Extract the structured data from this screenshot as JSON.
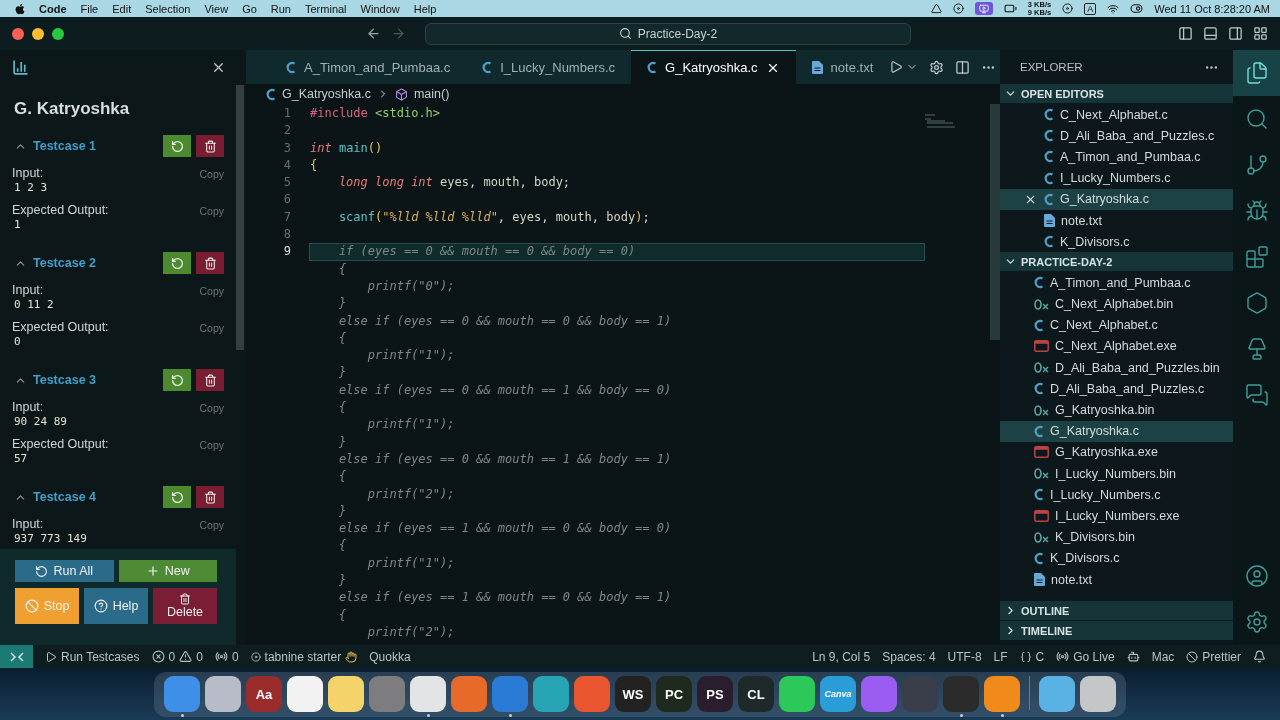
{
  "menubar": {
    "app": "Code",
    "menus": [
      "File",
      "Edit",
      "Selection",
      "View",
      "Go",
      "Run",
      "Terminal",
      "Window",
      "Help"
    ],
    "net_up": "3 KB/s",
    "net_down": "9 KB/s",
    "input_source": "A",
    "clock": "Wed 11 Oct 8:28:20 AM"
  },
  "title_bar": {
    "search": "Practice-Day-2"
  },
  "test_panel": {
    "problem": "G. Katryoshka",
    "testcases": [
      {
        "title": "Testcase 1",
        "expanded": true,
        "fields": [
          {
            "label": "Input:",
            "value": "1 2 3",
            "copy": "Copy"
          },
          {
            "label": "Expected Output:",
            "value": "1",
            "copy": "Copy"
          }
        ]
      },
      {
        "title": "Testcase 2",
        "expanded": true,
        "fields": [
          {
            "label": "Input:",
            "value": "0 11 2",
            "copy": "Copy"
          },
          {
            "label": "Expected Output:",
            "value": "0",
            "copy": "Copy"
          }
        ]
      },
      {
        "title": "Testcase 3",
        "expanded": true,
        "fields": [
          {
            "label": "Input:",
            "value": "90 24 89",
            "copy": "Copy"
          },
          {
            "label": "Expected Output:",
            "value": "57",
            "copy": "Copy"
          }
        ]
      },
      {
        "title": "Testcase 4",
        "expanded": true,
        "fields": [
          {
            "label": "Input:",
            "value": "937 773 149",
            "copy": "Copy"
          }
        ]
      }
    ],
    "actions": [
      {
        "buttons": [
          {
            "kind": "run_all",
            "label": "Run All"
          },
          {
            "kind": "new",
            "label": "New"
          }
        ]
      },
      {
        "buttons": [
          {
            "kind": "stop",
            "label": "Stop"
          },
          {
            "kind": "help",
            "label": "Help"
          },
          {
            "kind": "delete",
            "label": "Delete"
          }
        ]
      }
    ]
  },
  "tabs": [
    {
      "label": "A_Timon_and_Pumbaa.c",
      "kind": "c",
      "selected": false
    },
    {
      "label": "I_Lucky_Numbers.c",
      "kind": "c",
      "selected": false
    },
    {
      "label": "G_Katryoshka.c",
      "kind": "c",
      "selected": true
    },
    {
      "label": "note.txt",
      "kind": "txt",
      "selected": false
    }
  ],
  "editor": {
    "breadcrumb": {
      "file": "G_Katryoshka.c",
      "symbol": "main()"
    },
    "lines": [
      {
        "number": "1",
        "current": false,
        "tokens": [
          {
            "text": "#include ",
            "kind": "directive"
          },
          {
            "text": "<stdio.h>",
            "kind": "header"
          }
        ]
      },
      {
        "number": "2",
        "current": false
      },
      {
        "number": "3",
        "current": false,
        "tokens": [
          {
            "text": "int ",
            "kind": "type"
          },
          {
            "text": "main",
            "kind": "func"
          },
          {
            "text": "()",
            "kind": "paren"
          }
        ]
      },
      {
        "number": "4",
        "current": false,
        "tokens": [
          {
            "text": "{",
            "kind": "paren"
          }
        ]
      },
      {
        "number": "5",
        "current": false,
        "tokens": [
          {
            "text": "    long long int",
            "kind": "type"
          },
          {
            "text": " eyes, mouth, body;",
            "kind": "plain"
          }
        ]
      },
      {
        "number": "6",
        "current": false
      },
      {
        "number": "7",
        "current": false,
        "tokens": [
          {
            "text": "    scanf",
            "kind": "func"
          },
          {
            "text": "(",
            "kind": "paren"
          },
          {
            "text": "\"%lld %lld %lld\"",
            "kind": "string"
          },
          {
            "text": ", eyes, mouth, body",
            "kind": "plain"
          },
          {
            "text": ")",
            "kind": "paren"
          },
          {
            "text": ";",
            "kind": "plain"
          }
        ]
      },
      {
        "number": "8",
        "current": false
      },
      {
        "number": "9",
        "current": true,
        "tokens": [
          {
            "text": "    if (eyes == 0 && mouth == 0 && body == 0)",
            "kind": "ghost"
          }
        ]
      },
      {
        "current": false,
        "tokens": [
          {
            "text": "    {",
            "kind": "ghost"
          }
        ]
      },
      {
        "current": false,
        "tokens": [
          {
            "text": "        printf(\"0\");",
            "kind": "ghost"
          }
        ]
      },
      {
        "current": false,
        "tokens": [
          {
            "text": "    }",
            "kind": "ghost"
          }
        ]
      },
      {
        "current": false,
        "tokens": [
          {
            "text": "    else if (eyes == 0 && mouth == 0 && body == 1)",
            "kind": "ghost"
          }
        ]
      },
      {
        "current": false,
        "tokens": [
          {
            "text": "    {",
            "kind": "ghost"
          }
        ]
      },
      {
        "current": false,
        "tokens": [
          {
            "text": "        printf(\"1\");",
            "kind": "ghost"
          }
        ]
      },
      {
        "current": false,
        "tokens": [
          {
            "text": "    }",
            "kind": "ghost"
          }
        ]
      },
      {
        "current": false,
        "tokens": [
          {
            "text": "    else if (eyes == 0 && mouth == 1 && body == 0)",
            "kind": "ghost"
          }
        ]
      },
      {
        "current": false,
        "tokens": [
          {
            "text": "    {",
            "kind": "ghost"
          }
        ]
      },
      {
        "current": false,
        "tokens": [
          {
            "text": "        printf(\"1\");",
            "kind": "ghost"
          }
        ]
      },
      {
        "current": false,
        "tokens": [
          {
            "text": "    }",
            "kind": "ghost"
          }
        ]
      },
      {
        "current": false,
        "tokens": [
          {
            "text": "    else if (eyes == 0 && mouth == 1 && body == 1)",
            "kind": "ghost"
          }
        ]
      },
      {
        "current": false,
        "tokens": [
          {
            "text": "    {",
            "kind": "ghost"
          }
        ]
      },
      {
        "current": false,
        "tokens": [
          {
            "text": "        printf(\"2\");",
            "kind": "ghost"
          }
        ]
      },
      {
        "current": false,
        "tokens": [
          {
            "text": "    }",
            "kind": "ghost"
          }
        ]
      },
      {
        "current": false,
        "tokens": [
          {
            "text": "    else if (eyes == 1 && mouth == 0 && body == 0)",
            "kind": "ghost"
          }
        ]
      },
      {
        "current": false,
        "tokens": [
          {
            "text": "    {",
            "kind": "ghost"
          }
        ]
      },
      {
        "current": false,
        "tokens": [
          {
            "text": "        printf(\"1\");",
            "kind": "ghost"
          }
        ]
      },
      {
        "current": false,
        "tokens": [
          {
            "text": "    }",
            "kind": "ghost"
          }
        ]
      },
      {
        "current": false,
        "tokens": [
          {
            "text": "    else if (eyes == 1 && mouth == 0 && body == 1)",
            "kind": "ghost"
          }
        ]
      },
      {
        "current": false,
        "tokens": [
          {
            "text": "    {",
            "kind": "ghost"
          }
        ]
      },
      {
        "current": false,
        "tokens": [
          {
            "text": "        printf(\"2\");",
            "kind": "ghost"
          }
        ]
      }
    ]
  },
  "explorer": {
    "title": "EXPLORER",
    "sections": [
      {
        "title": "OPEN EDITORS",
        "expanded": true,
        "items": [
          {
            "name": "C_Next_Alphabet.c",
            "kind": "c",
            "selected": false
          },
          {
            "name": "D_Ali_Baba_and_Puzzles.c",
            "kind": "c",
            "selected": false
          },
          {
            "name": "A_Timon_and_Pumbaa.c",
            "kind": "c",
            "selected": false
          },
          {
            "name": "I_Lucky_Numbers.c",
            "kind": "c",
            "selected": false
          },
          {
            "name": "G_Katryoshka.c",
            "kind": "c",
            "selected": true
          },
          {
            "name": "note.txt",
            "kind": "txt",
            "selected": false
          },
          {
            "name": "K_Divisors.c",
            "kind": "c",
            "selected": false
          }
        ]
      },
      {
        "title": "PRACTICE-DAY-2",
        "expanded": true,
        "items": [
          {
            "name": "A_Timon_and_Pumbaa.c",
            "kind": "c",
            "selected": false
          },
          {
            "name": "C_Next_Alphabet.bin",
            "kind": "bin",
            "selected": false
          },
          {
            "name": "C_Next_Alphabet.c",
            "kind": "c",
            "selected": false
          },
          {
            "name": "C_Next_Alphabet.exe",
            "kind": "exe",
            "selected": false
          },
          {
            "name": "D_Ali_Baba_and_Puzzles.bin",
            "kind": "bin",
            "selected": false
          },
          {
            "name": "D_Ali_Baba_and_Puzzles.c",
            "kind": "c",
            "selected": false
          },
          {
            "name": "G_Katryoshka.bin",
            "kind": "bin",
            "selected": false
          },
          {
            "name": "G_Katryoshka.c",
            "kind": "c",
            "selected": true
          },
          {
            "name": "G_Katryoshka.exe",
            "kind": "exe",
            "selected": false
          },
          {
            "name": "I_Lucky_Numbers.bin",
            "kind": "bin",
            "selected": false
          },
          {
            "name": "I_Lucky_Numbers.c",
            "kind": "c",
            "selected": false
          },
          {
            "name": "I_Lucky_Numbers.exe",
            "kind": "exe",
            "selected": false
          },
          {
            "name": "K_Divisors.bin",
            "kind": "bin",
            "selected": false
          },
          {
            "name": "K_Divisors.c",
            "kind": "c",
            "selected": false
          },
          {
            "name": "note.txt",
            "kind": "txt",
            "selected": false
          }
        ]
      },
      {
        "title": "OUTLINE",
        "expanded": false
      },
      {
        "title": "TIMELINE",
        "expanded": false
      }
    ]
  },
  "activity_bar": [
    {
      "kind": "files",
      "selected": true
    },
    {
      "kind": "search",
      "selected": false
    },
    {
      "kind": "source_control",
      "selected": false
    },
    {
      "kind": "run_debug",
      "selected": false
    },
    {
      "kind": "extensions",
      "selected": false
    },
    {
      "kind": "hexagon",
      "selected": false
    },
    {
      "kind": "lamp",
      "selected": false
    },
    {
      "kind": "chat",
      "selected": false
    },
    {
      "kind": "account",
      "selected": false
    },
    {
      "kind": "settings",
      "selected": false
    }
  ],
  "status_bar": {
    "left": [
      {
        "kind": "run",
        "label": "Run Testcases"
      },
      {
        "kind": "problems",
        "errors": "0",
        "warnings": "0"
      },
      {
        "kind": "ports",
        "label": "0"
      },
      {
        "kind": "tabnine",
        "label": "tabnine starter"
      },
      {
        "kind": "plain",
        "label": "Quokka"
      }
    ],
    "right": [
      {
        "kind": "plain",
        "label": "Ln 9, Col 5"
      },
      {
        "kind": "plain",
        "label": "Spaces: 4"
      },
      {
        "kind": "plain",
        "label": "UTF-8"
      },
      {
        "kind": "plain",
        "label": "LF"
      },
      {
        "kind": "language",
        "label": "C"
      },
      {
        "kind": "golive",
        "label": "Go Live"
      },
      {
        "kind": "copilot"
      },
      {
        "kind": "plain",
        "label": "Mac"
      },
      {
        "kind": "prettier",
        "label": "Prettier"
      },
      {
        "kind": "bell"
      }
    ]
  },
  "dock": {
    "apps": [
      {
        "color": "#3d8fe8",
        "running": true
      },
      {
        "color": "#b8bcc8",
        "running": false
      },
      {
        "color": "#9a2c2c",
        "label": "Aa",
        "running": false
      },
      {
        "color": "#f2f2f2",
        "running": false
      },
      {
        "color": "#f4d46a",
        "running": false
      },
      {
        "color": "#7d7d80",
        "running": false
      },
      {
        "color": "#e2e4e6",
        "running": true
      },
      {
        "color": "#e86a2a",
        "running": false
      },
      {
        "color": "#2a7bd6",
        "running": true
      },
      {
        "color": "#27a5b5",
        "running": false
      },
      {
        "color": "#e8552f",
        "running": false
      },
      {
        "color": "#222222",
        "label": "WS",
        "running": false
      },
      {
        "color": "#1e2a1e",
        "label": "PC",
        "running": false
      },
      {
        "color": "#2a1e2e",
        "label": "PS",
        "running": false
      },
      {
        "color": "#1e2a2a",
        "label": "CL",
        "running": false
      },
      {
        "color": "#2cc95a",
        "running": false
      },
      {
        "color": "#2a9cd8",
        "label": "Canva",
        "running": false
      },
      {
        "color": "#9b5cf2",
        "running": false
      },
      {
        "color": "#3a3d4a",
        "running": false
      },
      {
        "color": "#2b2b2b",
        "running": true
      },
      {
        "color": "#f08a1a",
        "running": true
      }
    ],
    "stacks": [
      {
        "color": "#5ab2e4",
        "running": false
      },
      {
        "color": "#c4c6c8",
        "running": false
      }
    ]
  }
}
